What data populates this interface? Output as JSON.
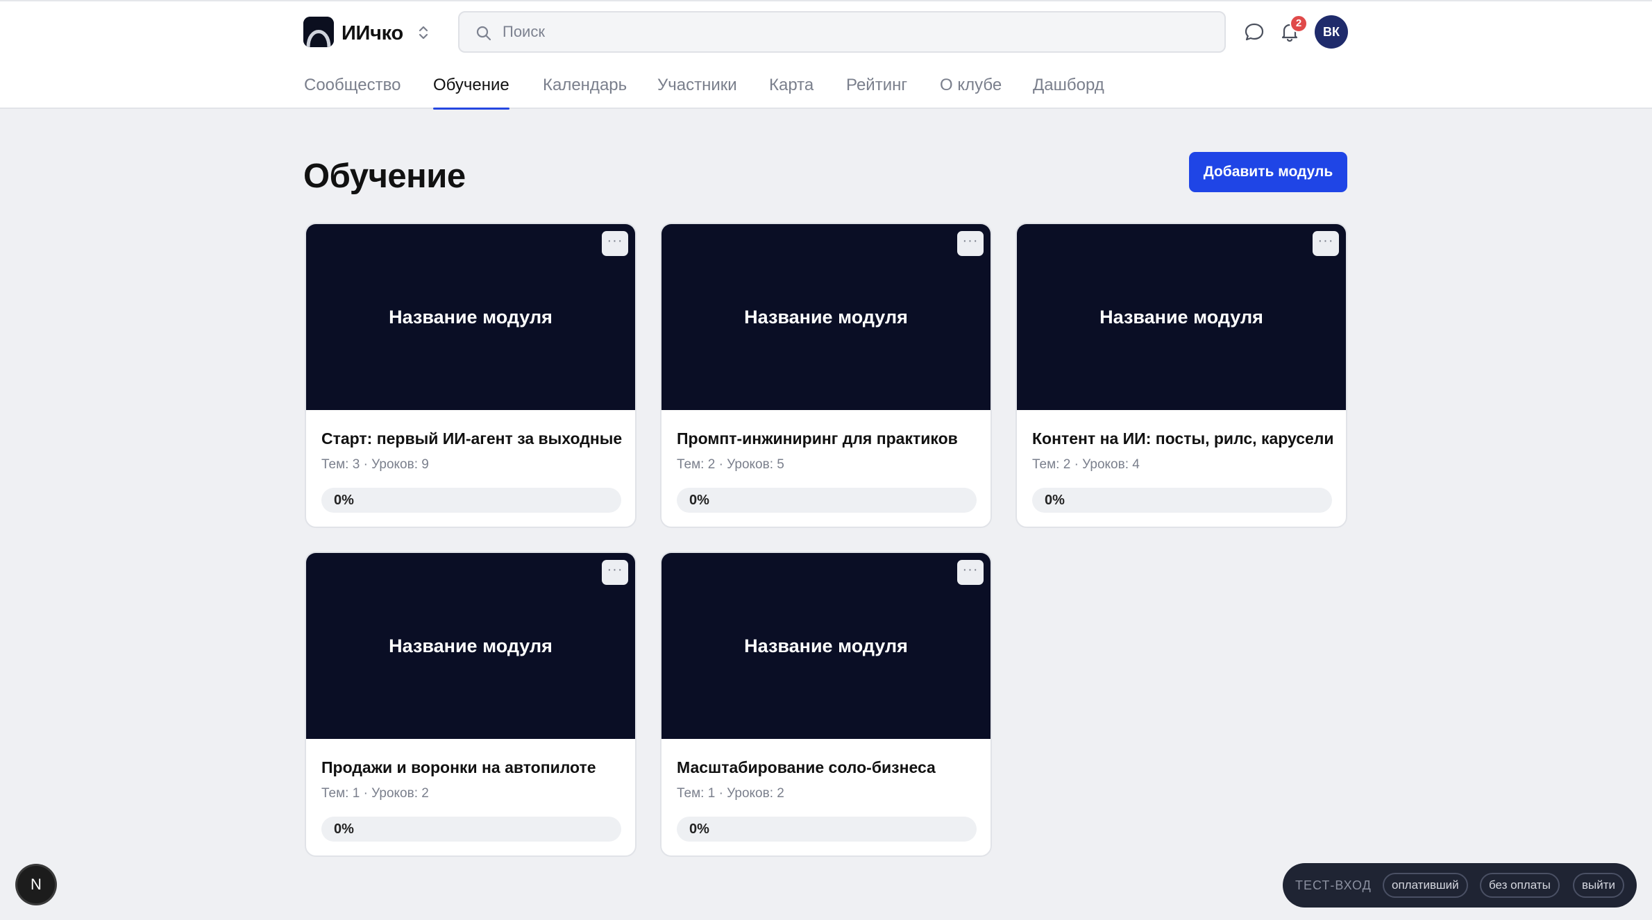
{
  "header": {
    "brand": "ИИчко",
    "search_placeholder": "Поиск",
    "notifications_count": "2",
    "avatar_initials": "ВК"
  },
  "nav": {
    "tabs": [
      {
        "label": "Сообщество",
        "active": false
      },
      {
        "label": "Обучение",
        "active": true
      },
      {
        "label": "Календарь",
        "active": false
      },
      {
        "label": "Участники",
        "active": false
      },
      {
        "label": "Карта",
        "active": false
      },
      {
        "label": "Рейтинг",
        "active": false
      },
      {
        "label": "О клубе",
        "active": false
      },
      {
        "label": "Дашборд",
        "active": false
      }
    ]
  },
  "main": {
    "title": "Обучение",
    "add_button": "Добавить модуль",
    "modules": [
      {
        "cover": "Название модуля",
        "title": "Старт: первый ИИ-агент за выходные",
        "meta": "Тем: 3 · Уроков: 9",
        "progress": 0,
        "progress_label": "0%"
      },
      {
        "cover": "Название модуля",
        "title": "Промпт-инжиниринг для практиков",
        "meta": "Тем: 2 · Уроков: 5",
        "progress": 0,
        "progress_label": "0%"
      },
      {
        "cover": "Название модуля",
        "title": "Контент на ИИ: посты, рилс, карусели",
        "meta": "Тем: 2 · Уроков: 4",
        "progress": 0,
        "progress_label": "0%"
      },
      {
        "cover": "Название модуля",
        "title": "Продажи и воронки на автопилоте",
        "meta": "Тем: 1 · Уроков: 2",
        "progress": 0,
        "progress_label": "0%"
      },
      {
        "cover": "Название модуля",
        "title": "Масштабирование соло-бизнеса",
        "meta": "Тем: 1 · Уроков: 2",
        "progress": 0,
        "progress_label": "0%"
      }
    ],
    "card_menu_glyph": "···"
  },
  "floating": {
    "n_badge": "N",
    "test_bar": {
      "label": "ТЕСТ-ВХОД",
      "buttons": [
        "оплативший",
        "без оплаты",
        "выйти"
      ]
    }
  },
  "colors": {
    "accent": "#1f45e6",
    "cover": "#0a0e25",
    "background": "#eff0f3",
    "badge": "#e04a4a",
    "avatar": "#1f2b6b"
  }
}
